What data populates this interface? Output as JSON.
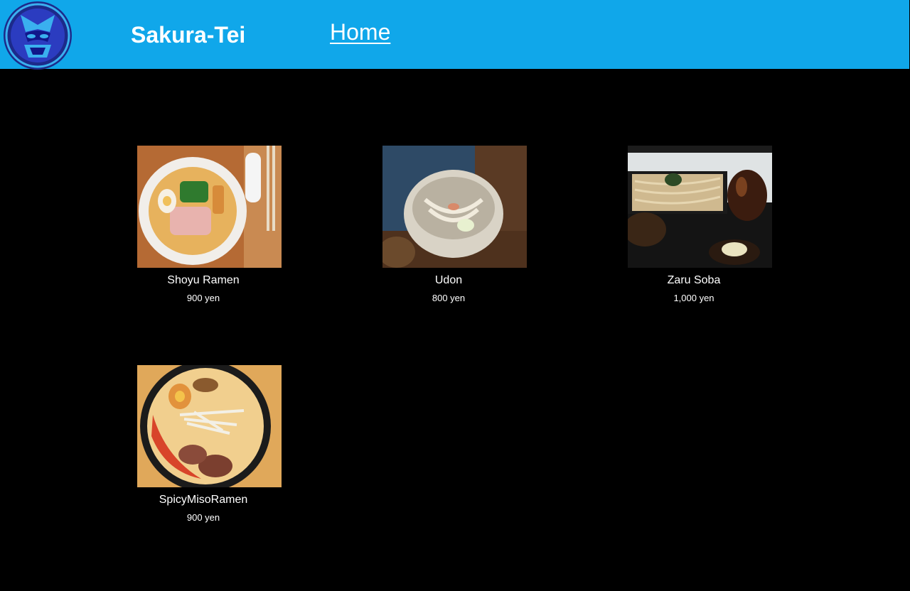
{
  "header": {
    "brand": "Sakura-Tei",
    "nav_home": "Home",
    "logo_icon": "samurai-mask-emblem-icon",
    "background_color": "#10a7ea"
  },
  "menu": {
    "items": [
      {
        "name": "Shoyu Ramen",
        "price": "900 yen",
        "image": "shoyu-ramen-photo"
      },
      {
        "name": "Udon",
        "price": "800 yen",
        "image": "udon-photo"
      },
      {
        "name": "Zaru Soba",
        "price": "1,000 yen",
        "image": "zaru-soba-photo"
      },
      {
        "name": "SpicyMisoRamen",
        "price": "900 yen",
        "image": "spicy-miso-ramen-photo"
      }
    ]
  }
}
